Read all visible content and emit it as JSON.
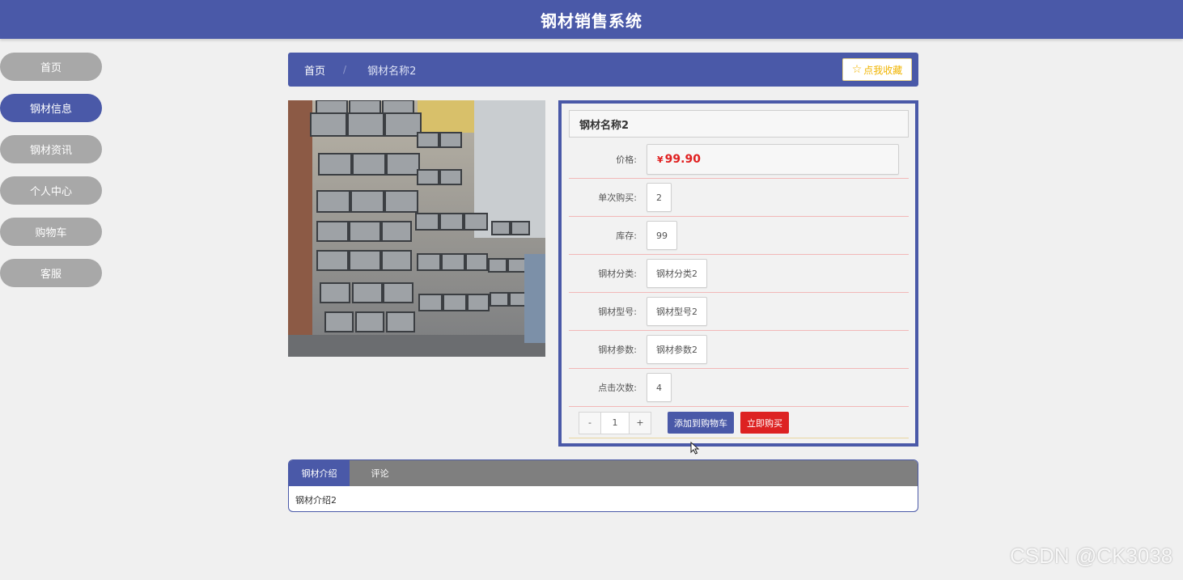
{
  "header": {
    "title": "钢材销售系统"
  },
  "sidebar": {
    "items": [
      {
        "label": "首页",
        "active": false
      },
      {
        "label": "钢材信息",
        "active": true
      },
      {
        "label": "钢材资讯",
        "active": false
      },
      {
        "label": "个人中心",
        "active": false
      },
      {
        "label": "购物车",
        "active": false
      },
      {
        "label": "客服",
        "active": false
      }
    ]
  },
  "breadcrumb": {
    "home": "首页",
    "separator": "/",
    "current": "钢材名称2"
  },
  "favorite": {
    "label": "点我收藏",
    "icon": "star-icon"
  },
  "product": {
    "name": "钢材名称2",
    "price_label": "价格:",
    "currency": "¥",
    "price": "99.90",
    "fields": [
      {
        "label": "单次购买:",
        "value": "2"
      },
      {
        "label": "库存:",
        "value": "99"
      },
      {
        "label": "钢材分类:",
        "value": "钢材分类2"
      },
      {
        "label": "钢材型号:",
        "value": "钢材型号2"
      },
      {
        "label": "钢材参数:",
        "value": "钢材参数2"
      },
      {
        "label": "点击次数:",
        "value": "4"
      }
    ]
  },
  "actions": {
    "minus": "-",
    "quantity": "1",
    "plus": "+",
    "add_to_cart": "添加到购物车",
    "buy_now": "立即购买"
  },
  "tabs": {
    "items": [
      {
        "label": "钢材介绍",
        "active": true
      },
      {
        "label": "评论",
        "active": false
      }
    ],
    "content": "钢材介绍2"
  },
  "watermark": "CSDN @CK3038",
  "colors": {
    "primary": "#4a59a8",
    "price": "#e02020",
    "buy": "#dd2222",
    "inactive_nav": "#a8a8a8",
    "favorite": "#f0b400"
  }
}
